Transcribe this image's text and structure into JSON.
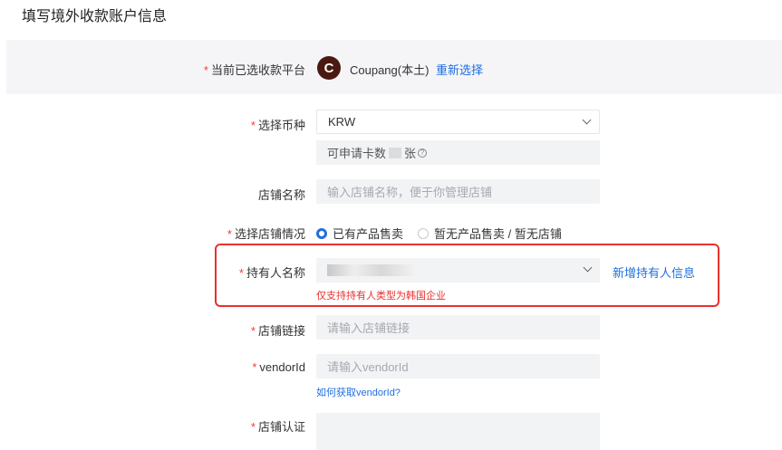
{
  "page": {
    "title": "填写境外收款账户信息"
  },
  "platform": {
    "label": "当前已选收款平台",
    "avatar_letter": "C",
    "name": "Coupang(本土)",
    "reselect_label": "重新选择"
  },
  "currency": {
    "label": "选择币种",
    "value": "KRW",
    "quota_prefix": "可申请卡数",
    "quota_suffix": "张"
  },
  "store_name": {
    "label": "店铺名称",
    "placeholder": "输入店铺名称，便于你管理店铺"
  },
  "store_status": {
    "label": "选择店铺情况",
    "options": [
      "已有产品售卖",
      "暂无产品售卖 / 暂无店铺"
    ],
    "selected": "已有产品售卖"
  },
  "holder": {
    "label": "持有人名称",
    "add_label": "新增持有人信息",
    "error": "仅支持持有人类型为韩国企业"
  },
  "store_link": {
    "label": "店铺链接",
    "placeholder": "请输入店铺链接"
  },
  "vendor": {
    "label": "vendorId",
    "placeholder": "请输入vendorId",
    "help": "如何获取vendorId?"
  },
  "store_auth": {
    "label": "店铺认证"
  },
  "colors": {
    "accent": "#1f6fe0",
    "error": "#e8312f",
    "required": "#f23c3c"
  }
}
